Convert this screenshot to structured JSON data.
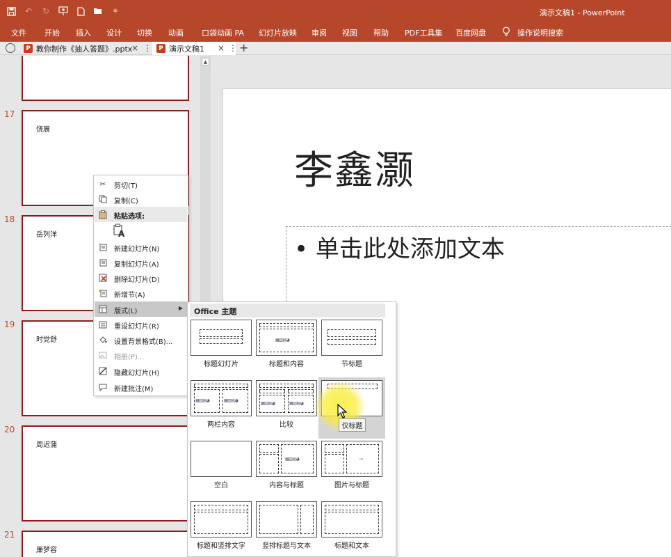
{
  "app": {
    "window_title": "演示文稿1  -  PowerPoint"
  },
  "qat": {
    "items": [
      "save-icon",
      "undo-icon",
      "redo-icon",
      "presenter-icon",
      "new-file-icon",
      "open-folder-icon",
      "customize-qat-icon"
    ]
  },
  "ribbon": {
    "tabs": [
      "文件",
      "开始",
      "插入",
      "设计",
      "切换",
      "动画",
      "口袋动画 PA",
      "幻灯片放映",
      "审阅",
      "视图",
      "帮助",
      "PDF工具集",
      "百度网盘"
    ],
    "search_label": "操作说明搜索"
  },
  "doc_tabs": {
    "tab1": "教你制作《抽人答题》.pptx",
    "tab2": "演示文稿1",
    "ppt_letter": "P",
    "close": "×",
    "more": "⋮",
    "add": "+"
  },
  "thumbnails": [
    {
      "num": "17",
      "name": "饶展"
    },
    {
      "num": "18",
      "name": "岳列洋"
    },
    {
      "num": "19",
      "name": "时党舒"
    },
    {
      "num": "20",
      "name": "周迟蒲"
    },
    {
      "num": "21",
      "name": "廉梦容"
    }
  ],
  "slide": {
    "title": "李鑫灏",
    "bullet_text": "• 单击此处添加文本"
  },
  "context_menu": {
    "cut": "剪切(T)",
    "copy": "复制(C)",
    "paste_options": "粘贴选项:",
    "new_slide": "新建幻灯片(N)",
    "duplicate_slide": "复制幻灯片(A)",
    "delete_slide": "删除幻灯片(D)",
    "add_section": "新增节(A)",
    "layout": "版式(L)",
    "reset_slide": "重设幻灯片(R)",
    "format_background": "设置背景格式(B)...",
    "photo_album": "相册(P)...",
    "hide_slide": "隐藏幻灯片(H)",
    "new_comment": "新建批注(M)"
  },
  "layout_submenu": {
    "header": "Office 主题",
    "layouts": [
      "标题幻灯片",
      "标题和内容",
      "节标题",
      "两栏内容",
      "比较",
      "仅标题",
      "空白",
      "内容与标题",
      "图片与标题",
      "标题和竖排文字",
      "竖排标题与文本",
      "标题和文本"
    ],
    "selected": "仅标题",
    "tooltip": "仅标题"
  },
  "colors": {
    "accent": "#b7472a",
    "thumb_border": "#8c1c1c"
  }
}
